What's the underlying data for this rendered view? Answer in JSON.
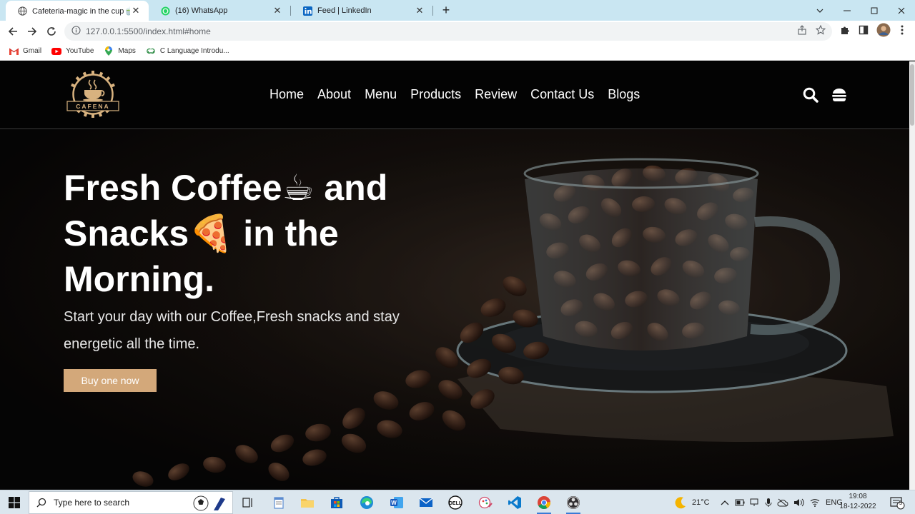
{
  "browser": {
    "tabs": [
      {
        "title": "Cafeteria-magic in the cup🍵",
        "favicon": "globe-icon",
        "active": true
      },
      {
        "title": "(16) WhatsApp",
        "favicon": "whatsapp-icon",
        "active": false
      },
      {
        "title": "Feed | LinkedIn",
        "favicon": "linkedin-icon",
        "active": false
      }
    ],
    "close_glyph": "✕",
    "new_tab_glyph": "+",
    "url": "127.0.0.1:5500/index.html#home",
    "bookmarks": [
      {
        "label": "Gmail",
        "icon": "gmail-icon"
      },
      {
        "label": "YouTube",
        "icon": "youtube-icon"
      },
      {
        "label": "Maps",
        "icon": "maps-icon"
      },
      {
        "label": "C Language Introdu...",
        "icon": "geeksforgeeks-icon"
      }
    ]
  },
  "site": {
    "logo_text": "CAFENA",
    "nav": [
      "Home",
      "About",
      "Menu",
      "Products",
      "Review",
      "Contact Us",
      "Blogs"
    ],
    "hero": {
      "title_line1": "Fresh Coffee",
      "title_emoji1": "☕",
      "title_line1b": "and",
      "title_line2": "Snacks",
      "title_emoji2": "🍕",
      "title_line2b": "in the",
      "title_line3": "Morning.",
      "subtitle": "Start your day with our Coffee,Fresh snacks and stay energetic all the time.",
      "button": "Buy one now"
    }
  },
  "taskbar": {
    "search_placeholder": "Type here to search",
    "weather": "21°C",
    "language": "ENG",
    "time": "19:08",
    "date": "18-12-2022",
    "notification_count": "5"
  },
  "colors": {
    "accent_button": "#d3a87a",
    "tabstrip": "#c9e6f2",
    "site_header": "#030303"
  }
}
